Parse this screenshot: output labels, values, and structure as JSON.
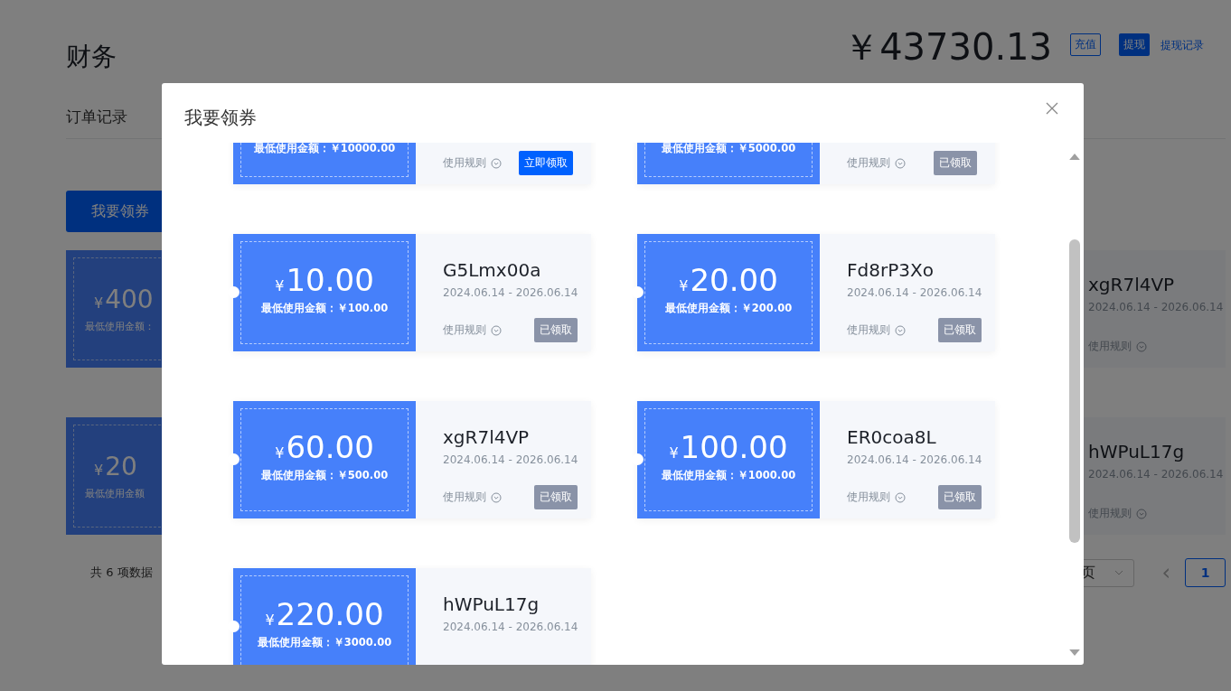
{
  "page": {
    "title": "财务",
    "balance": "￥43730.13",
    "recharge": "充值",
    "withdraw": "提现",
    "withdraw_log": "提现记录",
    "tab": "订单记录",
    "claim_button": "我要领券",
    "bg_rows": [
      {
        "amount": "400",
        "yen": "¥",
        "min": "最低使用金额：",
        "code": "xgR7l4VP",
        "dates": "2024.06.14 - 2026.06.14",
        "rule": "使用规则"
      },
      {
        "amount": "20",
        "yen": "¥",
        "min": "最低使用金额",
        "code": "hWPuL17g",
        "dates": "2024.06.14 - 2026.06.14",
        "rule": "使用规则"
      }
    ],
    "total": "共 6 项数据",
    "page_size": "页",
    "prev": "‹",
    "current_page": "1"
  },
  "modal": {
    "title": "我要领券",
    "coupons": [
      {
        "min": "最低使用金额：￥10000.00",
        "rule": "使用规则",
        "action": "立即领取",
        "claimed": false
      },
      {
        "min": "最低使用金额：￥5000.00",
        "rule": "使用规则",
        "action": "已领取",
        "claimed": true
      },
      {
        "yen": "¥",
        "amount": "10.00",
        "min": "最低使用金额：￥100.00",
        "code": "G5Lmx00a",
        "dates": "2024.06.14 - 2026.06.14",
        "rule": "使用规则",
        "action": "已领取",
        "claimed": true
      },
      {
        "yen": "¥",
        "amount": "20.00",
        "min": "最低使用金额：￥200.00",
        "code": "Fd8rP3Xo",
        "dates": "2024.06.14 - 2026.06.14",
        "rule": "使用规则",
        "action": "已领取",
        "claimed": true
      },
      {
        "yen": "¥",
        "amount": "60.00",
        "min": "最低使用金额：￥500.00",
        "code": "xgR7l4VP",
        "dates": "2024.06.14 - 2026.06.14",
        "rule": "使用规则",
        "action": "已领取",
        "claimed": true
      },
      {
        "yen": "¥",
        "amount": "100.00",
        "min": "最低使用金额：￥1000.00",
        "code": "ER0coa8L",
        "dates": "2024.06.14 - 2026.06.14",
        "rule": "使用规则",
        "action": "已领取",
        "claimed": true
      },
      {
        "yen": "¥",
        "amount": "220.00",
        "min": "最低使用金额：￥3000.00",
        "code": "hWPuL17g",
        "dates": "2024.06.14 - 2026.06.14"
      }
    ]
  }
}
